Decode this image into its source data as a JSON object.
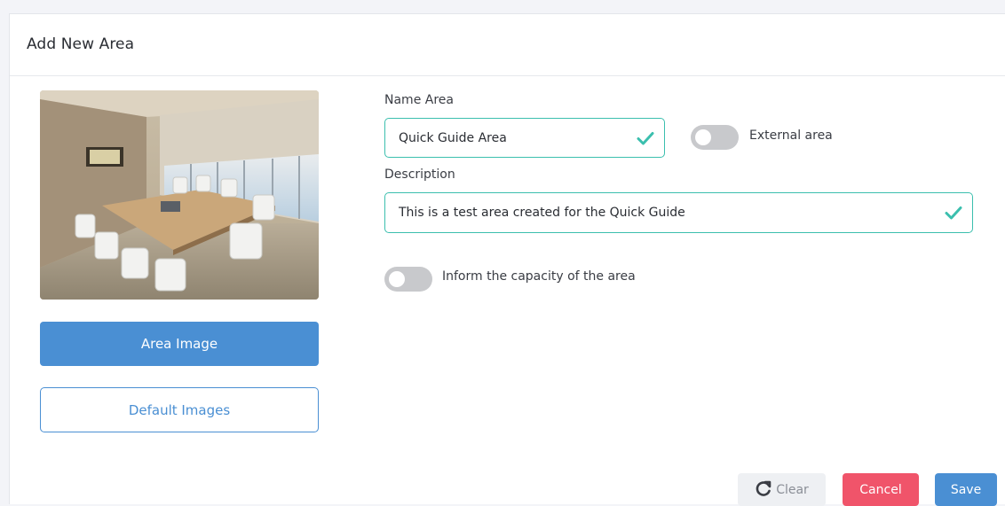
{
  "dialog": {
    "title": "Add New Area"
  },
  "image_panel": {
    "image_description_icon": "conference-room-photo",
    "area_image_label": "Area Image",
    "default_images_label": "Default Images"
  },
  "form": {
    "name_label": "Name Area",
    "name_value": "Quick Guide Area",
    "external_label": "External area",
    "external_on": false,
    "description_label": "Description",
    "description_value": "This is a test area created for the Quick Guide",
    "capacity_label": "Inform the capacity of the area",
    "capacity_on": false
  },
  "actions": {
    "clear_label": "Clear",
    "cancel_label": "Cancel",
    "save_label": "Save"
  },
  "colors": {
    "primary": "#4a8fd3",
    "valid": "#3bbfae",
    "danger": "#f0546a",
    "toggle_off": "#c8c9cc"
  }
}
